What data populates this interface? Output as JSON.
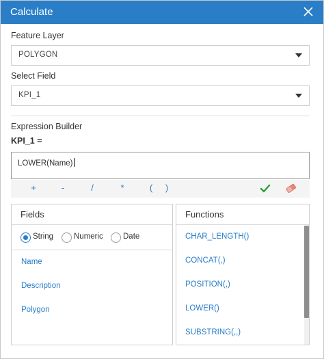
{
  "dialog": {
    "title": "Calculate",
    "close_icon": "close-icon"
  },
  "feature_layer": {
    "label": "Feature Layer",
    "value": "POLYGON"
  },
  "select_field": {
    "label": "Select Field",
    "value": "KPI_1"
  },
  "expression": {
    "label": "Expression Builder",
    "target": "KPI_1 =",
    "text": "LOWER(Name)"
  },
  "operators": [
    "+",
    "-",
    "/",
    "*",
    "(",
    ")"
  ],
  "toolbar_icons": {
    "apply": "check-icon",
    "clear": "eraser-icon"
  },
  "fields_panel": {
    "title": "Fields",
    "filters": [
      {
        "label": "String",
        "checked": true
      },
      {
        "label": "Numeric",
        "checked": false
      },
      {
        "label": "Date",
        "checked": false
      }
    ],
    "items": [
      "Name",
      "Description",
      "Polygon"
    ]
  },
  "functions_panel": {
    "title": "Functions",
    "items": [
      "CHAR_LENGTH()",
      "CONCAT(,)",
      "POSITION(,)",
      "LOWER()",
      "SUBSTRING(,,)"
    ]
  },
  "colors": {
    "accent": "#2a7ec8",
    "check": "#2e9e3a",
    "eraser": "#e2857a"
  }
}
